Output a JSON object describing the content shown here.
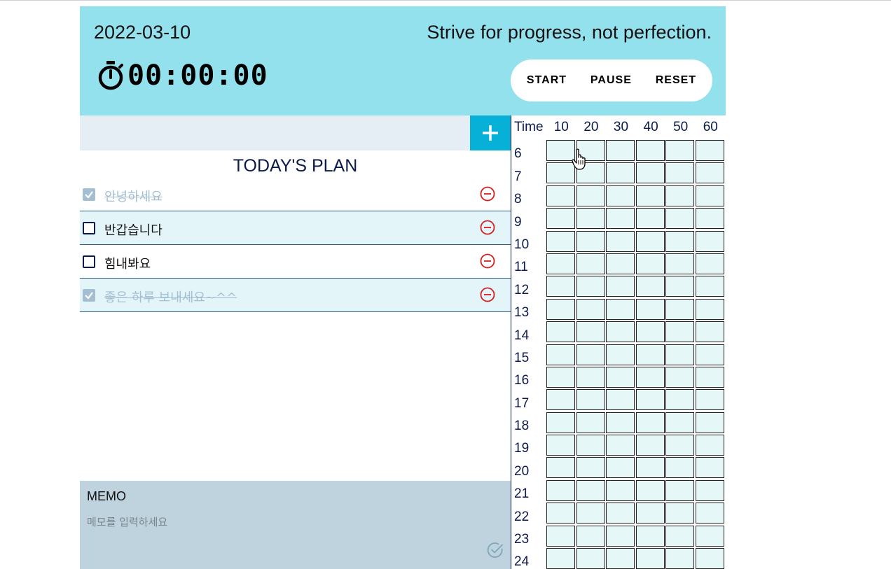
{
  "header": {
    "date": "2022-03-10",
    "quote": "Strive for progress, not perfection.",
    "timer": "00:00:00",
    "timer_icon": "stopwatch-icon",
    "buttons": {
      "start": "START",
      "pause": "PAUSE",
      "reset": "RESET"
    }
  },
  "todo": {
    "input_value": "",
    "add_icon": "plus-icon",
    "title": "TODAY'S PLAN",
    "items": [
      {
        "text": "안녕하세요",
        "done": true
      },
      {
        "text": "반갑습니다",
        "done": false
      },
      {
        "text": "힘내봐요",
        "done": false
      },
      {
        "text": "좋은 하루 보내세요~^^",
        "done": true
      }
    ],
    "remove_icon": "minus-circle-icon"
  },
  "memo": {
    "title": "MEMO",
    "placeholder": "메모를 입력하세요",
    "value": "",
    "save_icon": "check-circle-icon"
  },
  "timetable": {
    "header_label": "Time",
    "minutes": [
      "10",
      "20",
      "30",
      "40",
      "50",
      "60"
    ],
    "hours": [
      "6",
      "7",
      "8",
      "9",
      "10",
      "11",
      "12",
      "13",
      "14",
      "15",
      "16",
      "17",
      "18",
      "19",
      "20",
      "21",
      "22",
      "23",
      "24"
    ]
  },
  "colors": {
    "header_bg": "#94e1ee",
    "accent": "#06b0d6",
    "remove_red": "#d21f1f",
    "memo_bg": "#bfd3de",
    "cell_bg": "#e6f7f7",
    "text_navy": "#0b1a4a"
  }
}
